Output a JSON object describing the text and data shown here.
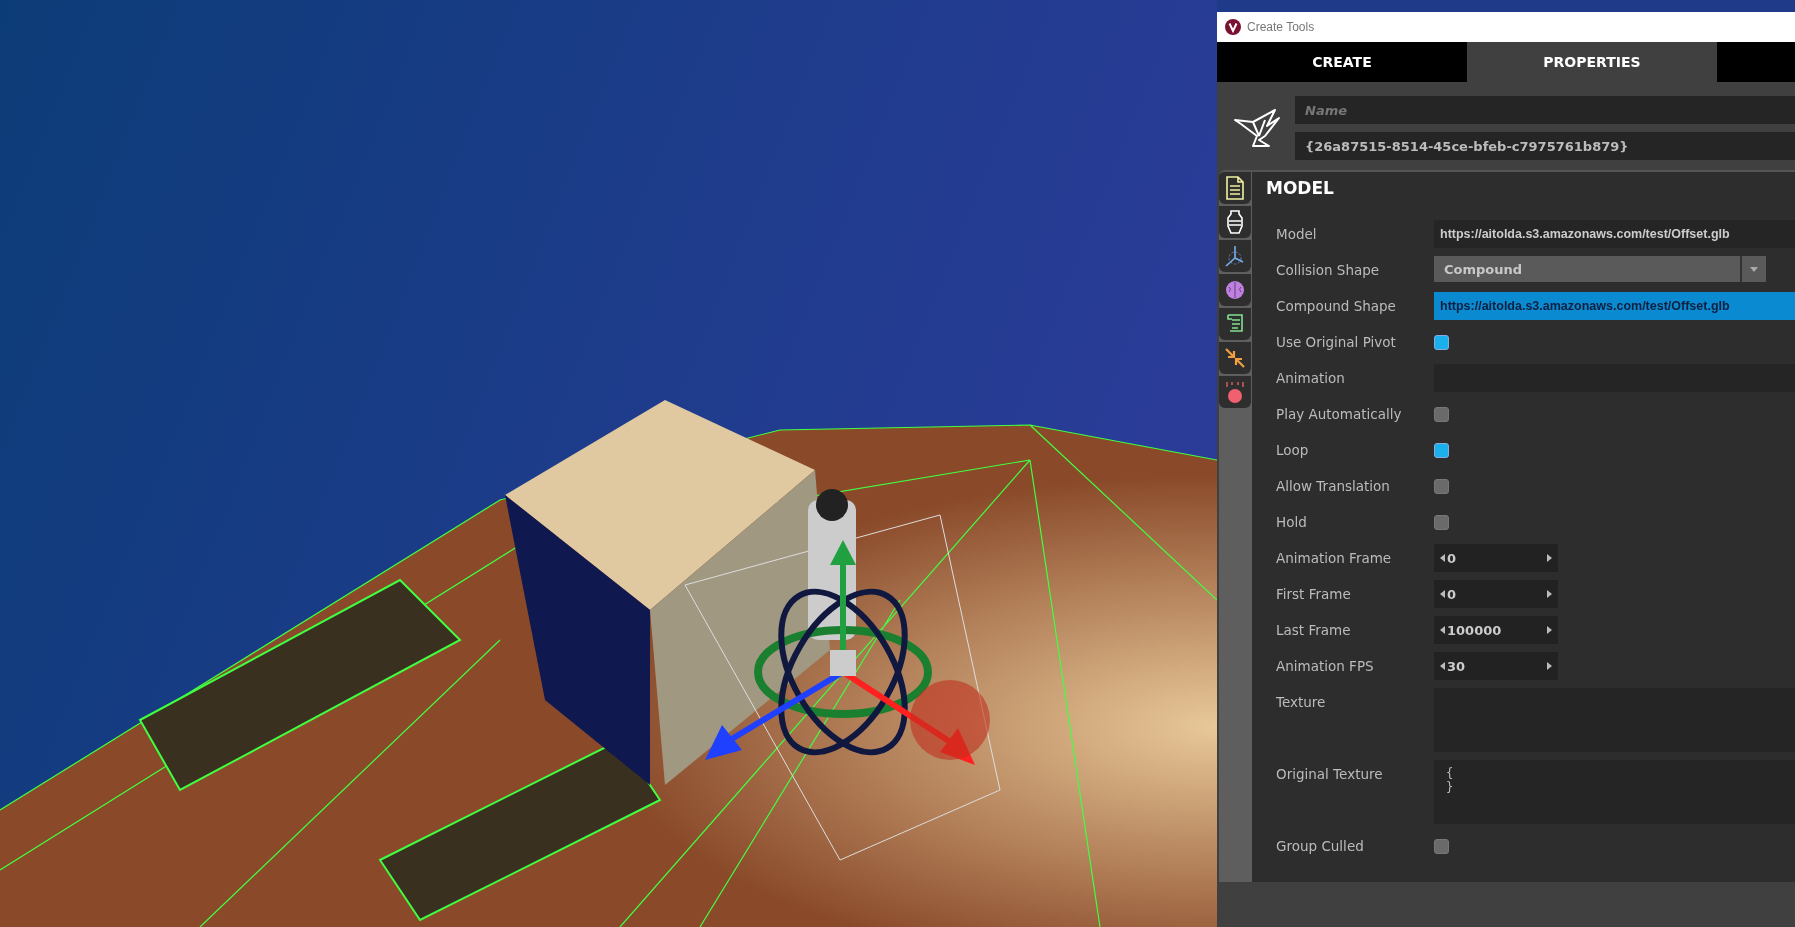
{
  "window": {
    "title": "Create Tools"
  },
  "tabs": [
    {
      "label": "CREATE",
      "selected": false
    },
    {
      "label": "PROPERTIES",
      "selected": true
    }
  ],
  "header": {
    "name_placeholder": "Name",
    "id": "{26a87515-8514-45ce-bfeb-c7975761b879}"
  },
  "section": {
    "title": "MODEL"
  },
  "properties": [
    {
      "kind": "text",
      "label": "Model",
      "value": "https://aitolda.s3.amazonaws.com/test/Offset.glb",
      "selected": false
    },
    {
      "kind": "dropdown",
      "label": "Collision Shape",
      "value": "Compound"
    },
    {
      "kind": "text",
      "label": "Compound Shape",
      "value": "https://aitolda.s3.amazonaws.com/test/Offset.glb",
      "selected": true
    },
    {
      "kind": "checkbox",
      "label": "Use Original Pivot",
      "checked": true
    },
    {
      "kind": "text",
      "label": "Animation",
      "selected": false
    },
    {
      "kind": "checkbox",
      "label": "Play Automatically",
      "checked": false
    },
    {
      "kind": "checkbox",
      "label": "Loop",
      "checked": true
    },
    {
      "kind": "checkbox",
      "label": "Allow Translation",
      "checked": false
    },
    {
      "kind": "checkbox",
      "label": "Hold",
      "checked": false
    },
    {
      "kind": "spinner",
      "label": "Animation Frame",
      "value": "0"
    },
    {
      "kind": "spinner",
      "label": "First Frame",
      "value": "0"
    },
    {
      "kind": "spinner",
      "label": "Last Frame",
      "value": "100000"
    },
    {
      "kind": "spinner",
      "label": "Animation FPS",
      "value": "30"
    },
    {
      "kind": "textarea",
      "label": "Texture"
    },
    {
      "kind": "textarea",
      "label": "Original Texture",
      "value": "{\n}"
    },
    {
      "kind": "checkbox",
      "label": "Group Culled",
      "checked": false
    }
  ]
}
